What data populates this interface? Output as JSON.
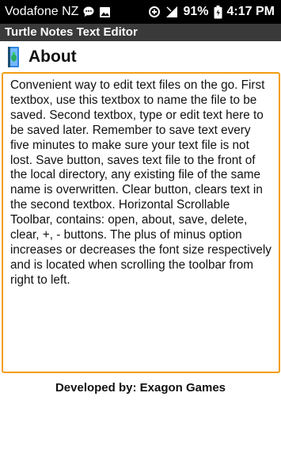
{
  "status_bar": {
    "carrier": "Vodafone NZ",
    "battery": "91%",
    "time": "4:17",
    "time_suffix": "PM",
    "icons": [
      "chat-bubble-icon",
      "image-icon",
      "data-saver-icon",
      "signal-icon",
      "battery-icon"
    ]
  },
  "app_bar": {
    "title": "Turtle Notes Text Editor"
  },
  "about": {
    "icon": "app-icon",
    "title": "About",
    "body": "Convenient way to edit text files on the go. First textbox, use this textbox to name the file to be saved. Second textbox, type or edit text here to be saved later. Remember to save text every five minutes to make sure your text file is not lost. Save button, saves text file to the front of the local directory, any existing file of the same name is overwritten. Clear button, clears text in the second textbox. Horizontal Scrollable Toolbar, contains: open, about, save, delete, clear, +, - buttons. The plus of minus option increases or decreases the font size respectively and is located when scrolling the toolbar from right to left."
  },
  "footer": {
    "credit": "Developed by: Exagon Games"
  },
  "colors": {
    "status_bar": "#000000",
    "app_bar": "#3a3a3a",
    "textbox_border": "#f39c12"
  }
}
